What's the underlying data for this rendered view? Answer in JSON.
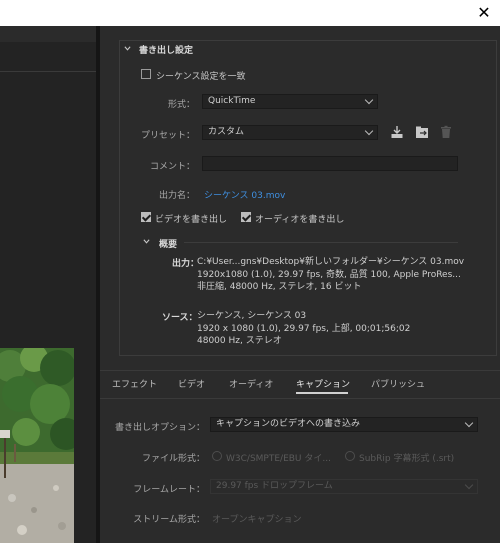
{
  "window": {
    "close_glyph": "✕"
  },
  "export_settings": {
    "section_title": "書き出し設定",
    "match_sequence_label": "シーケンス設定を一致",
    "match_sequence_checked": false,
    "format_label": "形式：",
    "format_value": "QuickTime",
    "preset_label": "プリセット：",
    "preset_value": "カスタム",
    "comment_label": "コメント：",
    "comment_value": "",
    "output_name_label": "出力名：",
    "output_name_value": "シーケンス 03.mov",
    "export_video_label": "ビデオを書き出し",
    "export_video_checked": true,
    "export_audio_label": "オーディオを書き出し",
    "export_audio_checked": true,
    "icons": [
      "save-preset-icon",
      "import-preset-icon",
      "delete-preset-icon"
    ]
  },
  "summary": {
    "title": "概要",
    "output_label": "出力：",
    "output_lines": [
      "C:¥User...gns¥Desktop¥新しいフォルダー¥シーケンス  03.mov",
      "1920x1080 (1.0), 29.97 fps, 奇数, 品質 100, Apple ProRes...",
      "非圧縮, 48000 Hz, ステレオ, 16 ビット"
    ],
    "source_label": "ソース：",
    "source_lines": [
      "シーケンス, シーケンス 03",
      "1920 x 1080 (1.0), 29.97 fps, 上部, 00;01;56;02",
      "48000  Hz, ステレオ"
    ]
  },
  "tabs": [
    {
      "label": "エフェクト",
      "active": false
    },
    {
      "label": "ビデオ",
      "active": false
    },
    {
      "label": "オーディオ",
      "active": false
    },
    {
      "label": "キャプション",
      "active": true
    },
    {
      "label": "パブリッシュ",
      "active": false
    }
  ],
  "captions": {
    "export_option_label": "書き出しオプション：",
    "export_option_value": "キャプションのビデオへの書き込み",
    "file_format_label": "ファイル形式：",
    "file_format_option1": "W3C/SMPTE/EBU タイ...",
    "file_format_option2": "SubRip 字幕形式 (.srt)",
    "frame_rate_label": "フレームレート：",
    "frame_rate_value": "29.97 fps ドロップフレーム",
    "stream_format_label": "ストリーム形式：",
    "stream_format_value": "オープンキャプション"
  }
}
